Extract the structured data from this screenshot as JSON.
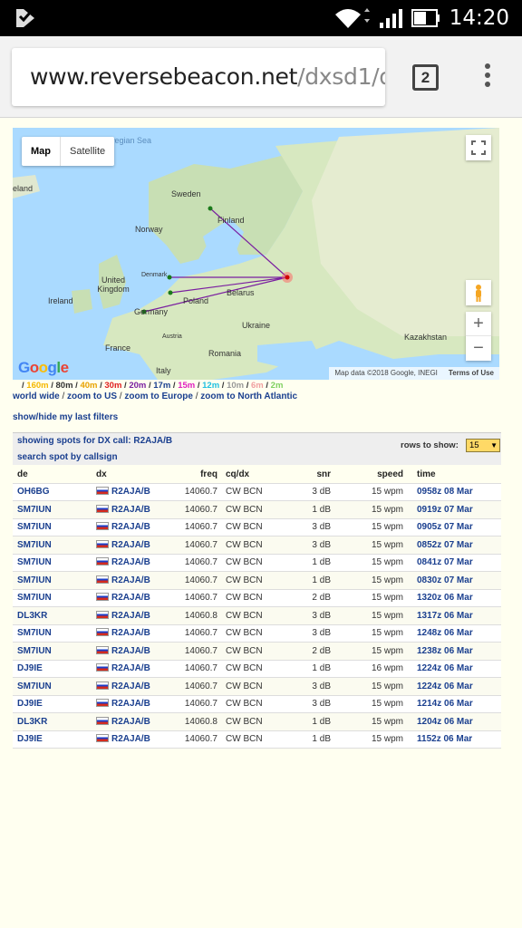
{
  "status_bar": {
    "time": "14:20"
  },
  "browser": {
    "url_host": "www.reversebeacon.net",
    "url_path": "/dxsd1/d",
    "tab_count": "2"
  },
  "map": {
    "type_buttons": [
      "Map",
      "Satellite"
    ],
    "labels": {
      "sea": "wegian Sea",
      "iceland": "eland",
      "sweden": "Sweden",
      "finland": "Finland",
      "norway": "Norway",
      "denmark": "Denmark",
      "uk": "United Kingdom",
      "ireland": "Ireland",
      "poland": "Poland",
      "belarus": "Belarus",
      "germany": "Germany",
      "ukraine": "Ukraine",
      "austria": "Austria",
      "france": "France",
      "romania": "Romania",
      "italy": "Italy",
      "kazakhstan": "Kazakhstan"
    },
    "logo": "Google",
    "credit": "Map data ©2018 Google, INEGI",
    "terms": "Terms of Use",
    "zoom_in": "+",
    "zoom_out": "−"
  },
  "bands": [
    {
      "label": "160m",
      "color": "#f5b800"
    },
    {
      "label": "80m",
      "color": "#333333"
    },
    {
      "label": "40m",
      "color": "#e8a200"
    },
    {
      "label": "30m",
      "color": "#e02020"
    },
    {
      "label": "20m",
      "color": "#7a1fa0"
    },
    {
      "label": "17m",
      "color": "#1a3f8f"
    },
    {
      "label": "15m",
      "color": "#e020c0"
    },
    {
      "label": "12m",
      "color": "#20c0e0"
    },
    {
      "label": "10m",
      "color": "#999999"
    },
    {
      "label": "6m",
      "color": "#f0a0a0"
    },
    {
      "label": "2m",
      "color": "#80d060"
    }
  ],
  "links": {
    "world": "world wide",
    "us": "zoom to US",
    "europe": "zoom to Europe",
    "na": "zoom to North Atlantic",
    "filters": "show/hide my last filters"
  },
  "panel": {
    "showing": "showing spots for DX call: R2AJA/B",
    "search": "search spot by callsign",
    "rows_label": "rows to show:",
    "rows_value": "15"
  },
  "table": {
    "headers": {
      "de": "de",
      "dx": "dx",
      "freq": "freq",
      "cq": "cq/dx",
      "snr": "snr",
      "speed": "speed",
      "time": "time"
    },
    "rows": [
      {
        "de": "OH6BG",
        "dx": "R2AJA/B",
        "freq": "14060.7",
        "cq": "CW BCN",
        "snr": "3 dB",
        "speed": "15 wpm",
        "time": "0958z 08 Mar"
      },
      {
        "de": "SM7IUN",
        "dx": "R2AJA/B",
        "freq": "14060.7",
        "cq": "CW BCN",
        "snr": "1 dB",
        "speed": "15 wpm",
        "time": "0919z 07 Mar"
      },
      {
        "de": "SM7IUN",
        "dx": "R2AJA/B",
        "freq": "14060.7",
        "cq": "CW BCN",
        "snr": "3 dB",
        "speed": "15 wpm",
        "time": "0905z 07 Mar"
      },
      {
        "de": "SM7IUN",
        "dx": "R2AJA/B",
        "freq": "14060.7",
        "cq": "CW BCN",
        "snr": "3 dB",
        "speed": "15 wpm",
        "time": "0852z 07 Mar"
      },
      {
        "de": "SM7IUN",
        "dx": "R2AJA/B",
        "freq": "14060.7",
        "cq": "CW BCN",
        "snr": "1 dB",
        "speed": "15 wpm",
        "time": "0841z 07 Mar"
      },
      {
        "de": "SM7IUN",
        "dx": "R2AJA/B",
        "freq": "14060.7",
        "cq": "CW BCN",
        "snr": "1 dB",
        "speed": "15 wpm",
        "time": "0830z 07 Mar"
      },
      {
        "de": "SM7IUN",
        "dx": "R2AJA/B",
        "freq": "14060.7",
        "cq": "CW BCN",
        "snr": "2 dB",
        "speed": "15 wpm",
        "time": "1320z 06 Mar"
      },
      {
        "de": "DL3KR",
        "dx": "R2AJA/B",
        "freq": "14060.8",
        "cq": "CW BCN",
        "snr": "3 dB",
        "speed": "15 wpm",
        "time": "1317z 06 Mar"
      },
      {
        "de": "SM7IUN",
        "dx": "R2AJA/B",
        "freq": "14060.7",
        "cq": "CW BCN",
        "snr": "3 dB",
        "speed": "15 wpm",
        "time": "1248z 06 Mar"
      },
      {
        "de": "SM7IUN",
        "dx": "R2AJA/B",
        "freq": "14060.7",
        "cq": "CW BCN",
        "snr": "2 dB",
        "speed": "15 wpm",
        "time": "1238z 06 Mar"
      },
      {
        "de": "DJ9IE",
        "dx": "R2AJA/B",
        "freq": "14060.7",
        "cq": "CW BCN",
        "snr": "1 dB",
        "speed": "16 wpm",
        "time": "1224z 06 Mar"
      },
      {
        "de": "SM7IUN",
        "dx": "R2AJA/B",
        "freq": "14060.7",
        "cq": "CW BCN",
        "snr": "3 dB",
        "speed": "15 wpm",
        "time": "1224z 06 Mar"
      },
      {
        "de": "DJ9IE",
        "dx": "R2AJA/B",
        "freq": "14060.7",
        "cq": "CW BCN",
        "snr": "3 dB",
        "speed": "15 wpm",
        "time": "1214z 06 Mar"
      },
      {
        "de": "DL3KR",
        "dx": "R2AJA/B",
        "freq": "14060.8",
        "cq": "CW BCN",
        "snr": "1 dB",
        "speed": "15 wpm",
        "time": "1204z 06 Mar"
      },
      {
        "de": "DJ9IE",
        "dx": "R2AJA/B",
        "freq": "14060.7",
        "cq": "CW BCN",
        "snr": "1 dB",
        "speed": "15 wpm",
        "time": "1152z 06 Mar"
      }
    ]
  }
}
